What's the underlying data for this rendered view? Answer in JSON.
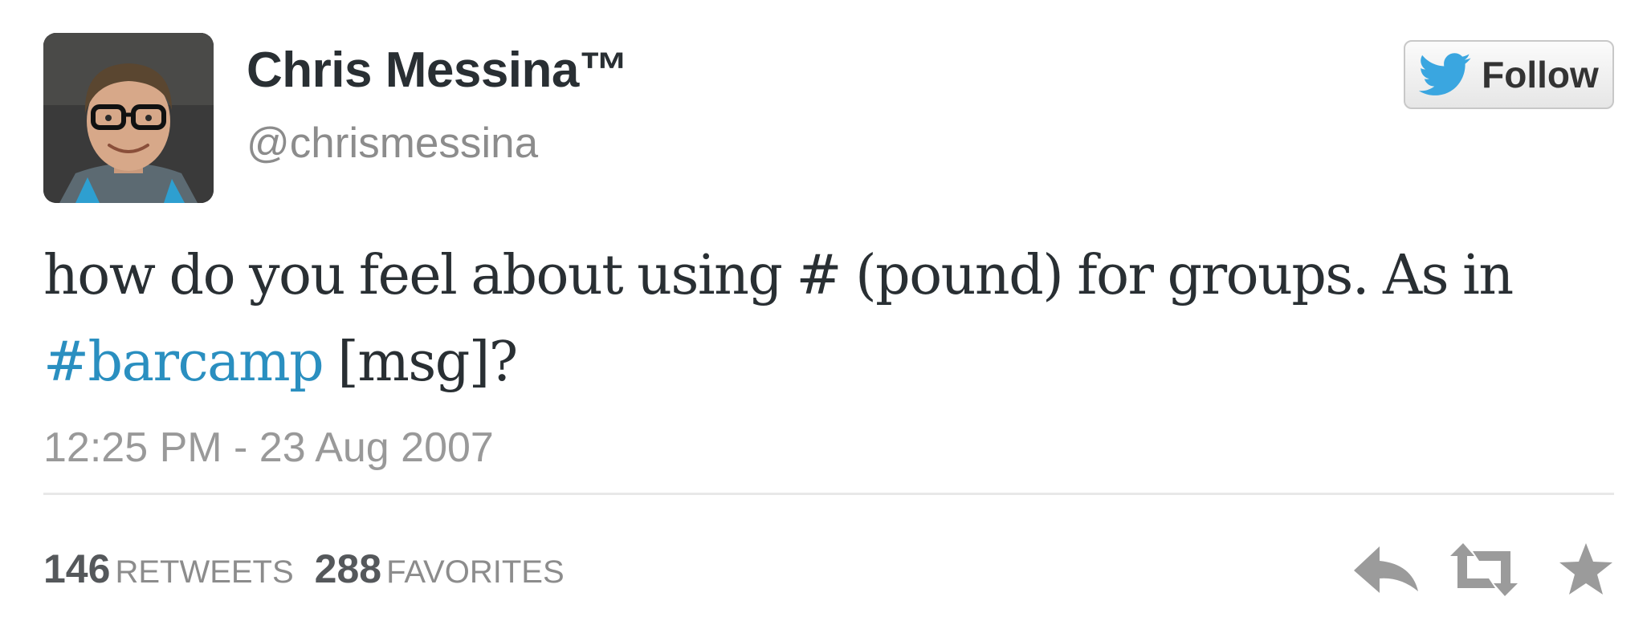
{
  "author": {
    "display_name": "Chris Messina™",
    "username": "@chrismessina"
  },
  "follow_button": {
    "label": "Follow",
    "icon": "twitter-bird-icon"
  },
  "tweet": {
    "text_before": "how do you feel about using # (pound) for groups. As in ",
    "hashtag": "#barcamp",
    "text_after": " [msg]?",
    "timestamp": "12:25 PM - 23 Aug 2007"
  },
  "stats": {
    "retweets_count": "146",
    "retweets_label": "RETWEETS",
    "favorites_count": "288",
    "favorites_label": "FAVORITES"
  },
  "actions": [
    {
      "name": "reply",
      "icon": "reply-icon"
    },
    {
      "name": "retweet",
      "icon": "retweet-icon"
    },
    {
      "name": "favorite",
      "icon": "star-icon"
    }
  ],
  "colors": {
    "hashtag": "#2a8fc0",
    "twitter_blue": "#3aa6e0",
    "text": "#292f33",
    "muted": "#8c8c8c",
    "icon_gray": "#9b9b9b"
  }
}
